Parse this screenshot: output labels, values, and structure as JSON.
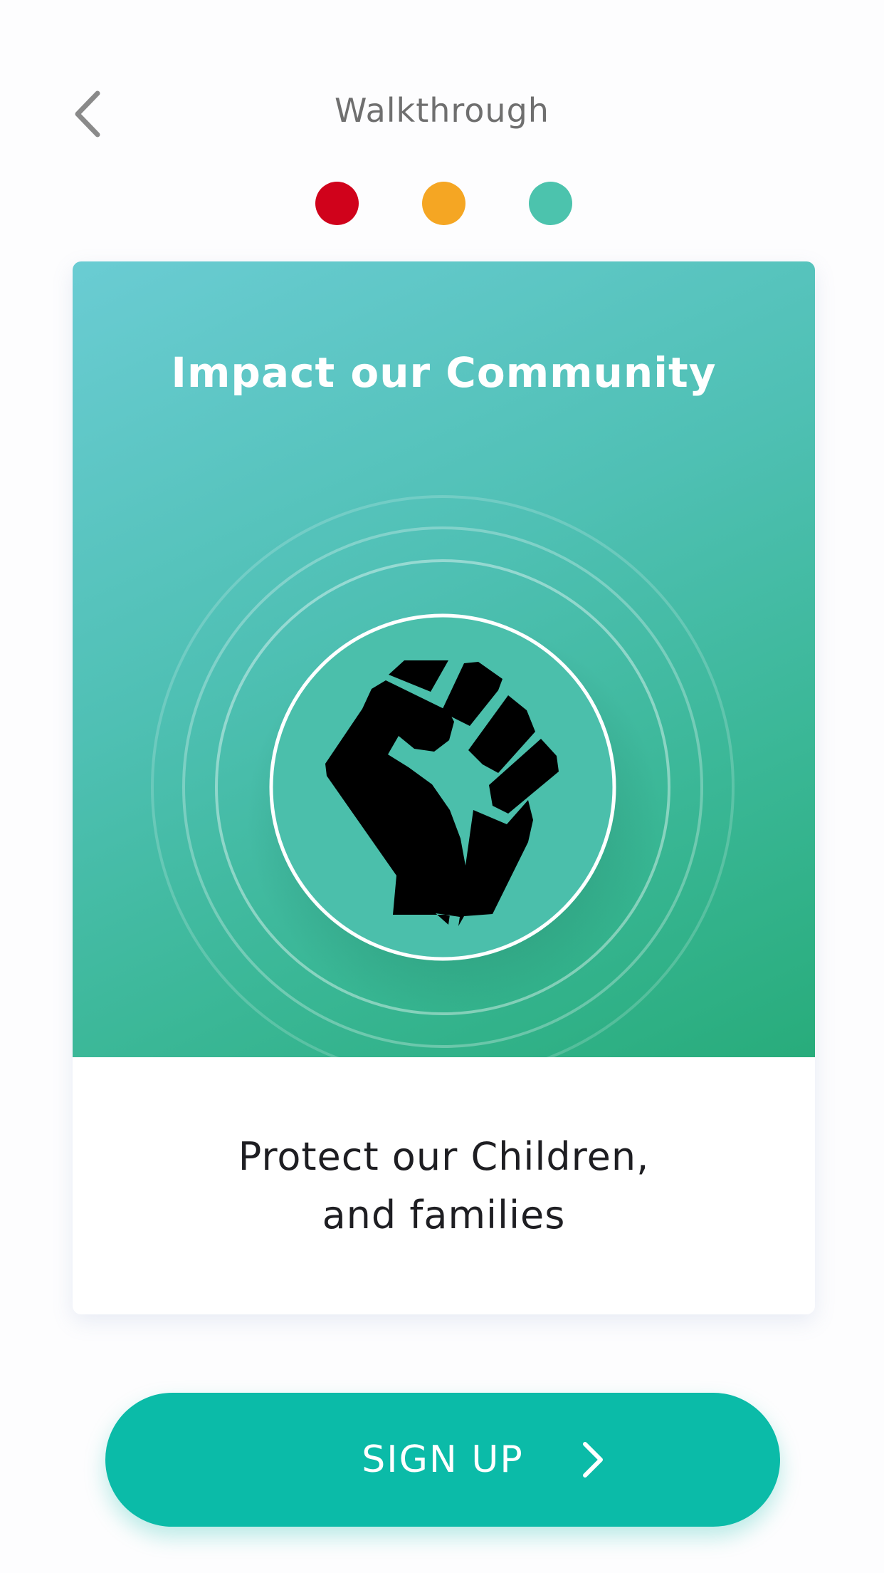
{
  "header": {
    "title": "Walkthrough",
    "back_icon": "chevron-left-icon"
  },
  "pagination": {
    "dots": [
      {
        "color": "#d0021b"
      },
      {
        "color": "#f5a623"
      },
      {
        "color": "#4cc3ad"
      }
    ]
  },
  "card": {
    "title": "Impact our Community",
    "icon": "raised-fist-icon",
    "caption_line1": "Protect our Children,",
    "caption_line2": "and families"
  },
  "signup": {
    "label": "SIGN UP",
    "icon": "chevron-right-icon"
  },
  "colors": {
    "accent": "#0bbba8",
    "hero_gradient_start": "#6accd3",
    "hero_gradient_end": "#28ac7b"
  }
}
